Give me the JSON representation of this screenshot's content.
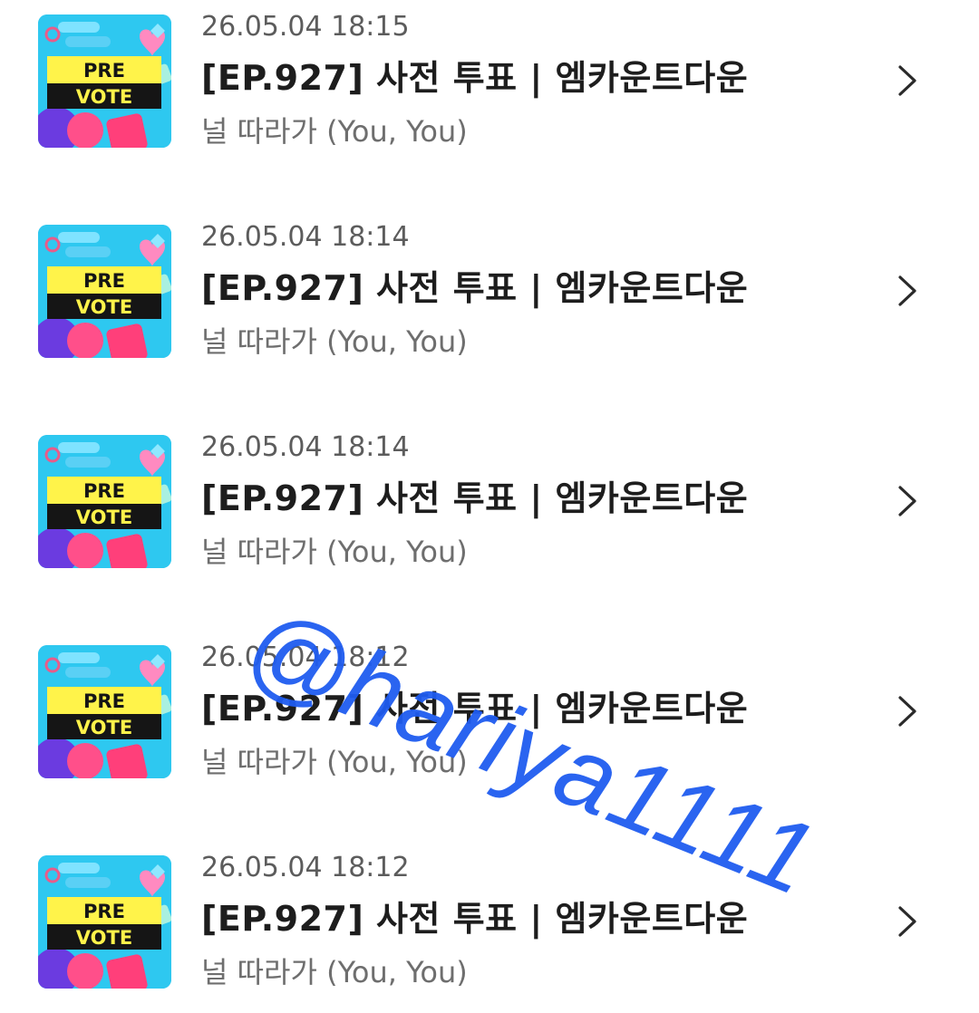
{
  "items": [
    {
      "timestamp": "26.05.04 18:15",
      "title": "[EP.927] 사전 투표 | 엠카운트다운",
      "subtitle": "널 따라가 (You, You)",
      "thumb_text_top": "PRE",
      "thumb_text_bottom": "VOTE"
    },
    {
      "timestamp": "26.05.04 18:14",
      "title": "[EP.927] 사전 투표 | 엠카운트다운",
      "subtitle": "널 따라가 (You, You)",
      "thumb_text_top": "PRE",
      "thumb_text_bottom": "VOTE"
    },
    {
      "timestamp": "26.05.04 18:14",
      "title": "[EP.927] 사전 투표 | 엠카운트다운",
      "subtitle": "널 따라가 (You, You)",
      "thumb_text_top": "PRE",
      "thumb_text_bottom": "VOTE"
    },
    {
      "timestamp": "26.05.04 18:12",
      "title": "[EP.927] 사전 투표 | 엠카운트다운",
      "subtitle": "널 따라가 (You, You)",
      "thumb_text_top": "PRE",
      "thumb_text_bottom": "VOTE"
    },
    {
      "timestamp": "26.05.04 18:12",
      "title": "[EP.927] 사전 투표 | 엠카운트다운",
      "subtitle": "널 따라가 (You, You)",
      "thumb_text_top": "PRE",
      "thumb_text_bottom": "VOTE"
    }
  ],
  "icons": {
    "chevron": "chevron-right-icon"
  },
  "watermark": {
    "text": "@hariya1111"
  },
  "colors": {
    "timestamp": "#5c5c5c",
    "title": "#1d1d1d",
    "subtitle": "#6e6e6e",
    "chevron": "#2a2a2a",
    "watermark": "#1f5cf0",
    "thumb_bg": "#2ec8f0",
    "thumb_banner": "#fff34a"
  }
}
